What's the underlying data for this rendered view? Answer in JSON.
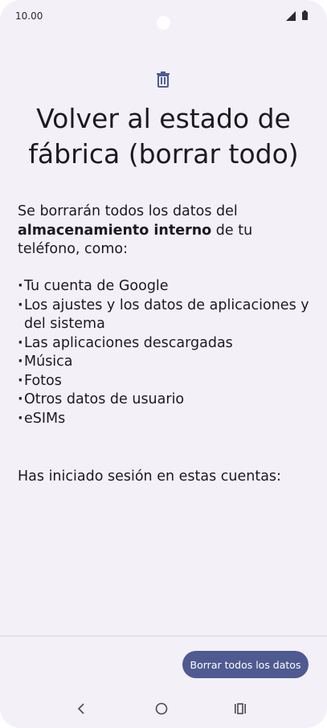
{
  "status_bar": {
    "time": "10.00",
    "signal_icon": "signal-icon",
    "battery_icon": "battery-icon"
  },
  "header": {
    "icon": "trash-icon",
    "title_line1": "Volver al estado de",
    "title_line2": "fábrica (borrar todo)"
  },
  "intro": {
    "text_before": "Se borrarán todos los datos del",
    "bold": "almacenamiento interno",
    "text_after": " de tu teléfono, como:"
  },
  "items": [
    "Tu cuenta de Google",
    "Los ajustes y los datos de aplicaciones y del sistema",
    "Las aplicaciones descargadas",
    "Música",
    "Fotos",
    "Otros datos de usuario",
    "eSIMs"
  ],
  "accounts_label": "Has iniciado sesión en estas cuentas:",
  "footer": {
    "primary_button": "Borrar todos los datos"
  },
  "nav": {
    "back": "back-icon",
    "home": "home-icon",
    "recents": "recents-icon"
  },
  "colors": {
    "background": "#f3f0f7",
    "accent": "#4f5a91",
    "text": "#1b1b1f"
  }
}
